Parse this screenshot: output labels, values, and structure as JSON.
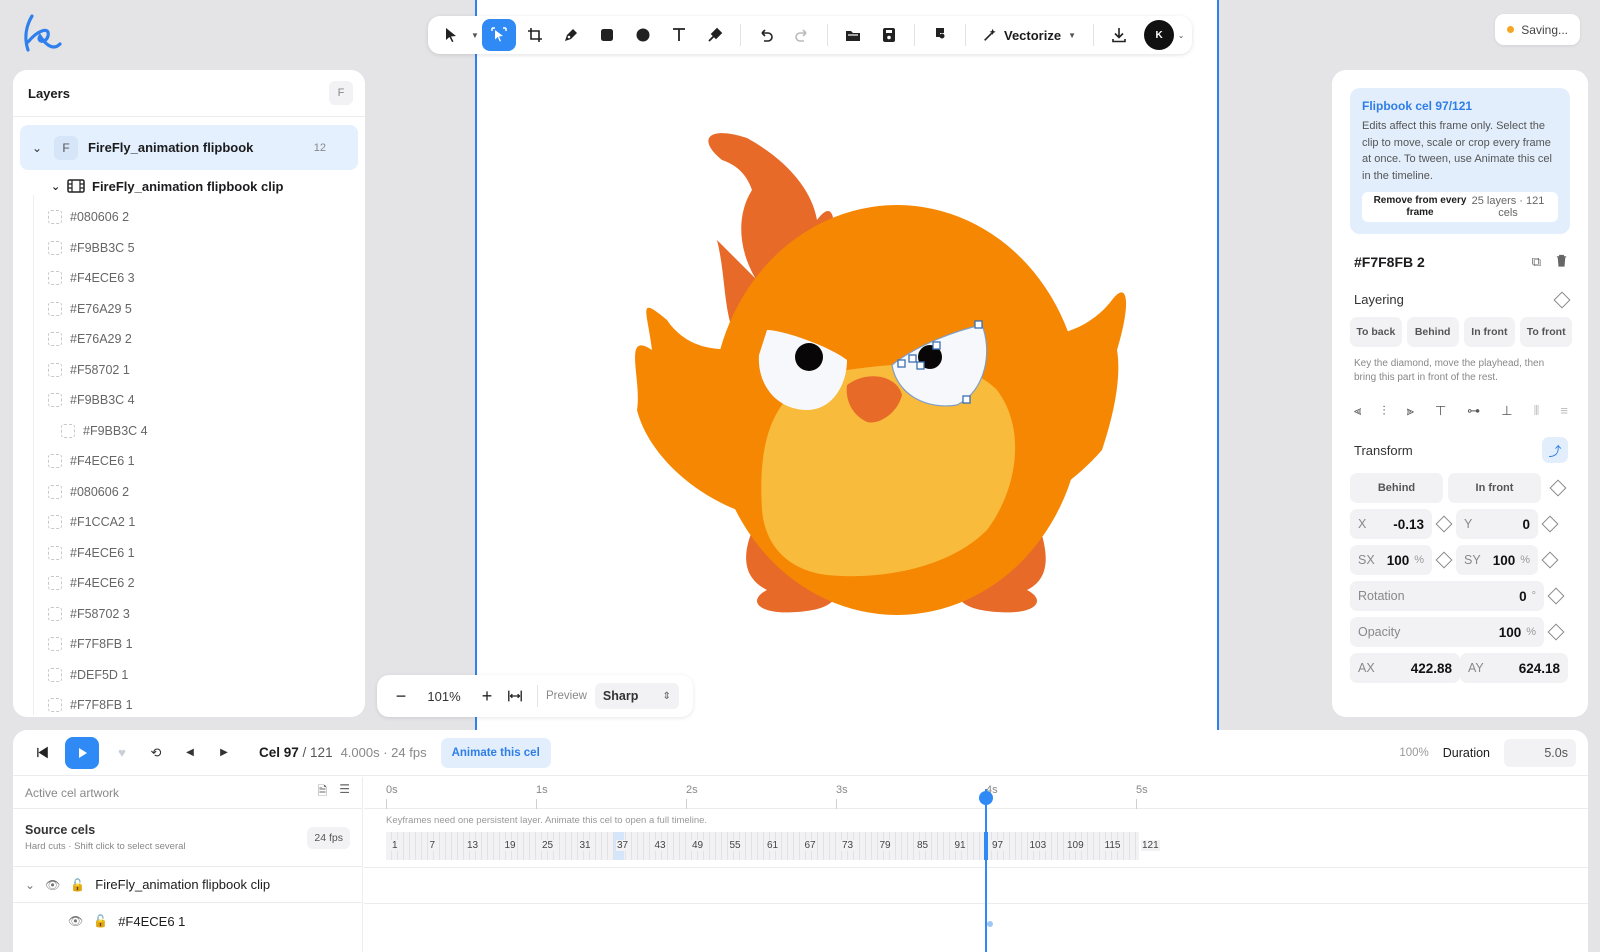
{
  "toolbar": {
    "vectorize_label": "Vectorize",
    "avatar_initial": "K"
  },
  "status": {
    "saving_label": "Saving..."
  },
  "layers": {
    "title": "Layers",
    "shortcut": "F",
    "root": {
      "badge": "F",
      "name": "FireFly_animation flipbook",
      "count": "12"
    },
    "clip_name": "FireFly_animation flipbook clip",
    "items": [
      {
        "name": "#080606 2",
        "sub": false
      },
      {
        "name": "#F9BB3C 5",
        "sub": false
      },
      {
        "name": "#F4ECE6 3",
        "sub": false
      },
      {
        "name": "#E76A29 5",
        "sub": false
      },
      {
        "name": "#E76A29 2",
        "sub": false
      },
      {
        "name": "#F58702 1",
        "sub": false
      },
      {
        "name": "#F9BB3C 4",
        "sub": false
      },
      {
        "name": "#F9BB3C 4",
        "sub": true
      },
      {
        "name": "#F4ECE6 1",
        "sub": false
      },
      {
        "name": "#080606 2",
        "sub": false
      },
      {
        "name": "#F1CCA2 1",
        "sub": false
      },
      {
        "name": "#F4ECE6 1",
        "sub": false
      },
      {
        "name": "#F4ECE6 2",
        "sub": false
      },
      {
        "name": "#F58702 3",
        "sub": false
      },
      {
        "name": "#F7F8FB 1",
        "sub": false
      },
      {
        "name": "#DEF5D 1",
        "sub": false
      },
      {
        "name": "#F7F8FB 1",
        "sub": false
      }
    ]
  },
  "zoom": {
    "value": "101%",
    "preview_label": "Preview",
    "preview_mode": "Sharp"
  },
  "inspector": {
    "info_title": "Flipbook cel 97/121",
    "info_text": "Edits affect this frame only. Select the clip to move, scale or crop every frame at once. To tween, use Animate this cel in the timeline.",
    "remove_label": "Remove from every frame",
    "remove_meta": "25 layers · 121 cels",
    "selected_name": "#F7F8FB 2",
    "layering_label": "Layering",
    "layering_buttons": [
      "To back",
      "Behind",
      "In front",
      "To front"
    ],
    "layering_hint": "Key the diamond, move the playhead, then bring this part in front of the rest.",
    "transform_label": "Transform",
    "transform_buttons": [
      "Behind",
      "In front"
    ],
    "x_label": "X",
    "x_value": "-0.13",
    "y_label": "Y",
    "y_value": "0",
    "sx_label": "SX",
    "sx_value": "100",
    "sx_unit": "%",
    "sy_label": "SY",
    "sy_value": "100",
    "sy_unit": "%",
    "rotation_label": "Rotation",
    "rotation_value": "0",
    "rotation_unit": "°",
    "opacity_label": "Opacity",
    "opacity_value": "100",
    "opacity_unit": "%",
    "ax_label": "AX",
    "ax_value": "422.88",
    "ay_label": "AY",
    "ay_value": "624.18"
  },
  "timeline": {
    "cel_current": "Cel 97",
    "cel_total": "/ 121",
    "time_meta": "4.000s · 24 fps",
    "animate_label": "Animate this cel",
    "zoom_pct": "100%",
    "duration_label": "Duration",
    "duration_value": "5.0s",
    "active_cel_label": "Active cel artwork",
    "source_cels_label": "Source cels",
    "source_cels_hint": "Hard cuts · Shift click to select several",
    "fps_badge": "24 fps",
    "keyframe_note": "Keyframes need one persistent layer. Animate this cel to open a full timeline.",
    "clip_row": "FireFly_animation flipbook clip",
    "layer_row": "#F4ECE6 1",
    "ruler_ticks": [
      "0s",
      "1s",
      "2s",
      "3s",
      "4s",
      "5s"
    ],
    "cel_labels": [
      "1",
      "7",
      "13",
      "19",
      "25",
      "31",
      "37",
      "43",
      "49",
      "55",
      "61",
      "67",
      "73",
      "79",
      "85",
      "91",
      "97",
      "103",
      "109",
      "115",
      "121"
    ]
  },
  "colors": {
    "accent": "#2f8af5",
    "bird_orange": "#F58702",
    "bird_flame": "#E76A29",
    "bird_belly": "#F9BB3C",
    "eye_white": "#F7F8FB"
  }
}
